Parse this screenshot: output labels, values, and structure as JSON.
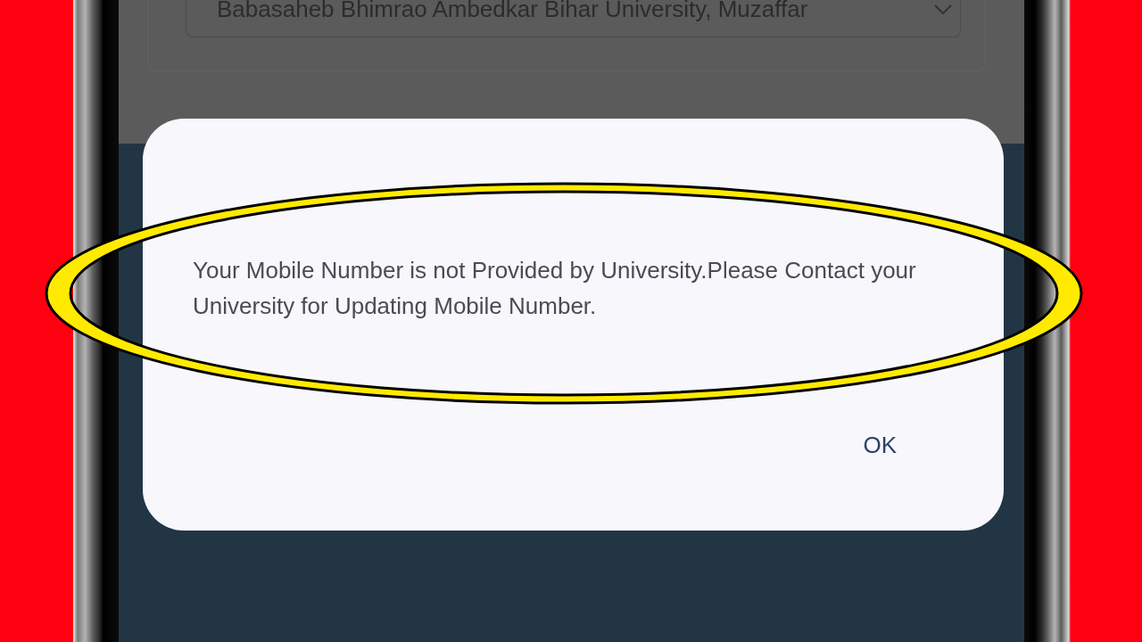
{
  "background_form": {
    "university_select": {
      "value": "Babasaheb Bhimrao Ambedkar Bihar University, Muzaffar"
    }
  },
  "dialog": {
    "message": "Your Mobile Number is not Provided by University.Please Contact your University for Updating Mobile Number.",
    "buttons": [
      {
        "label": "OK"
      }
    ]
  }
}
